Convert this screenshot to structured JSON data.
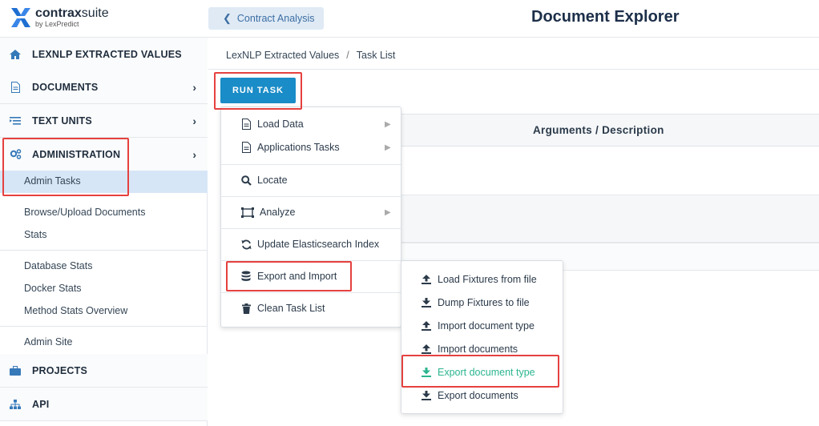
{
  "header": {
    "logo_brand": "contrax",
    "logo_suffix": "suite",
    "logo_by": "by LexPredict",
    "back_label": "Contract Analysis",
    "page_title": "Document Explorer"
  },
  "sidebar": {
    "main_items": [
      {
        "label": "LEXNLP EXTRACTED VALUES",
        "icon": "home-icon"
      },
      {
        "label": "DOCUMENTS",
        "icon": "document-icon"
      },
      {
        "label": "TEXT UNITS",
        "icon": "list-icon"
      },
      {
        "label": "ADMINISTRATION",
        "icon": "gears-icon"
      },
      {
        "label": "PROJECTS",
        "icon": "briefcase-icon"
      },
      {
        "label": "API",
        "icon": "sitemap-icon"
      }
    ],
    "sub_items": [
      "Admin Tasks",
      "Browse/Upload Documents",
      "Stats",
      "Database Stats",
      "Docker Stats",
      "Method Stats Overview",
      "Admin Site"
    ]
  },
  "breadcrumb": {
    "root": "LexNLP Extracted Values",
    "separator": "/",
    "current": "Task List"
  },
  "run_task_label": "RUN TASK",
  "table": {
    "column_header": "Arguments / Description"
  },
  "task_menu": [
    {
      "label": "Load Data",
      "icon": "document-icon",
      "submenu": true
    },
    {
      "label": "Applications Tasks",
      "icon": "document-icon",
      "submenu": true
    },
    {
      "label": "Locate",
      "icon": "search-icon",
      "submenu": false
    },
    {
      "label": "Analyze",
      "icon": "analyze-icon",
      "submenu": true
    },
    {
      "label": "Update Elasticsearch Index",
      "icon": "refresh-icon",
      "submenu": false
    },
    {
      "label": "Export and Import",
      "icon": "database-icon",
      "submenu": false
    },
    {
      "label": "Clean Task List",
      "icon": "trash-icon",
      "submenu": false
    }
  ],
  "export_menu": [
    {
      "label": "Load Fixtures from file",
      "icon": "upload-icon"
    },
    {
      "label": "Dump Fixtures to file",
      "icon": "download-icon"
    },
    {
      "label": "Import document type",
      "icon": "upload-icon"
    },
    {
      "label": "Import documents",
      "icon": "upload-icon"
    },
    {
      "label": "Export document type",
      "icon": "download-icon",
      "active": true
    },
    {
      "label": "Export documents",
      "icon": "download-icon"
    }
  ],
  "colors": {
    "accent": "#1a8cc7",
    "highlight": "#e5413f",
    "active_item": "#2bb58f",
    "sidebar_active": "#d7e6f7"
  }
}
